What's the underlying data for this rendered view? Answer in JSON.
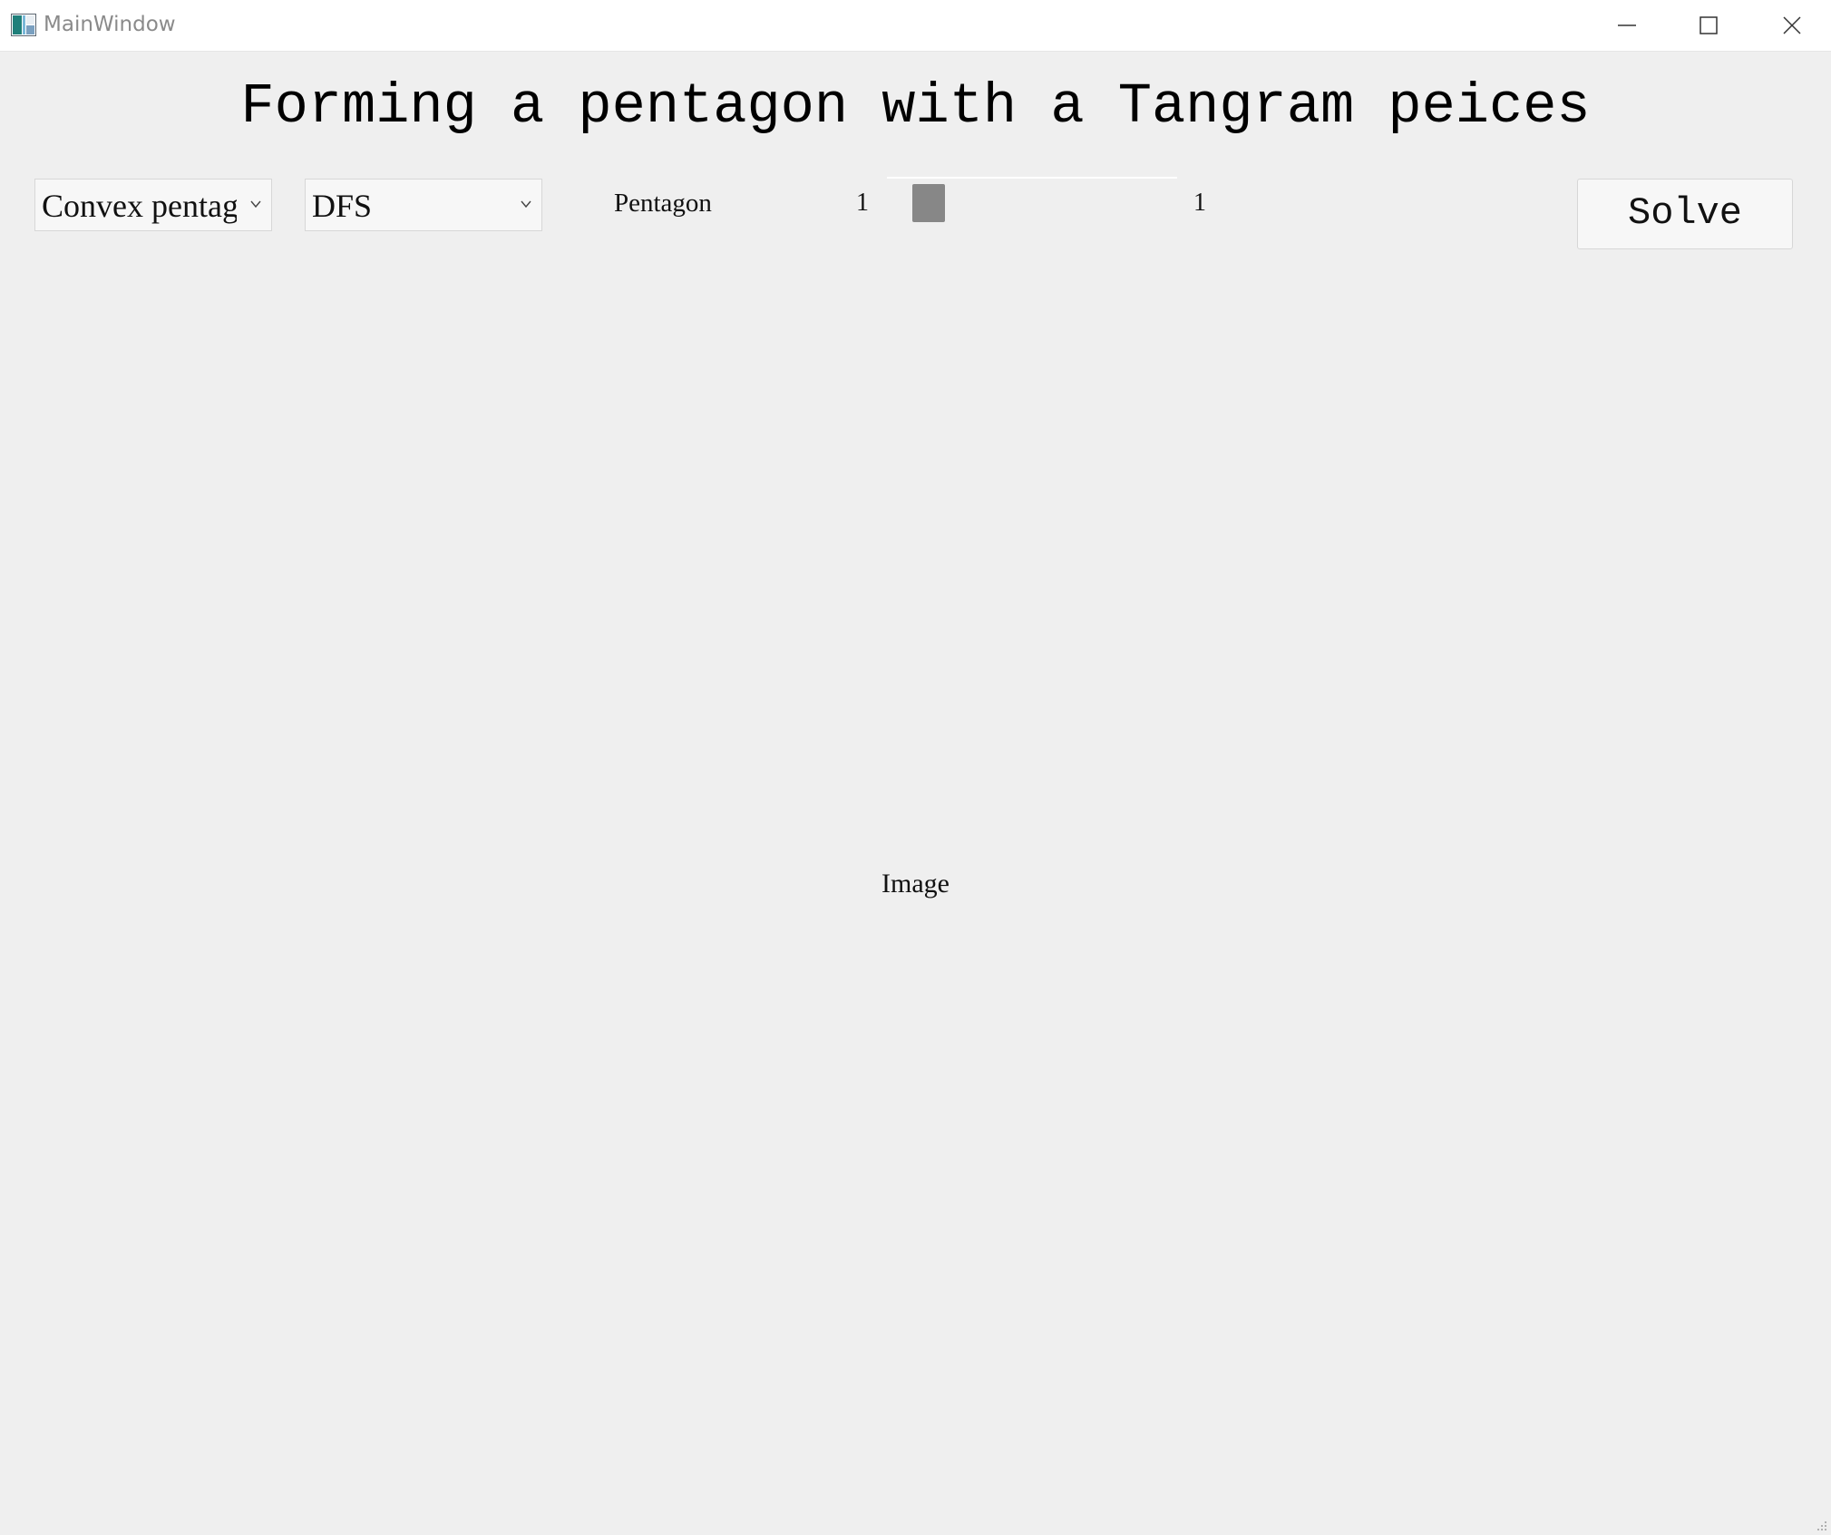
{
  "window": {
    "title": "MainWindow",
    "controls": [
      "minimize-icon",
      "maximize-icon",
      "close-icon"
    ]
  },
  "heading": "Forming a pentagon with a Tangram peices",
  "toolbar": {
    "shape_select": {
      "value": "Convex pentagon"
    },
    "algorithm_select": {
      "value": "DFS"
    },
    "shape_label": "Pentagon",
    "slider": {
      "min_label": "1",
      "max_label": "1",
      "value": 0.1
    },
    "solve_label": "Solve"
  },
  "canvas": {
    "placeholder": "Image"
  },
  "colors": {
    "background": "#efefef",
    "titlebar": "#ffffff",
    "slider_handle": "#878787"
  }
}
